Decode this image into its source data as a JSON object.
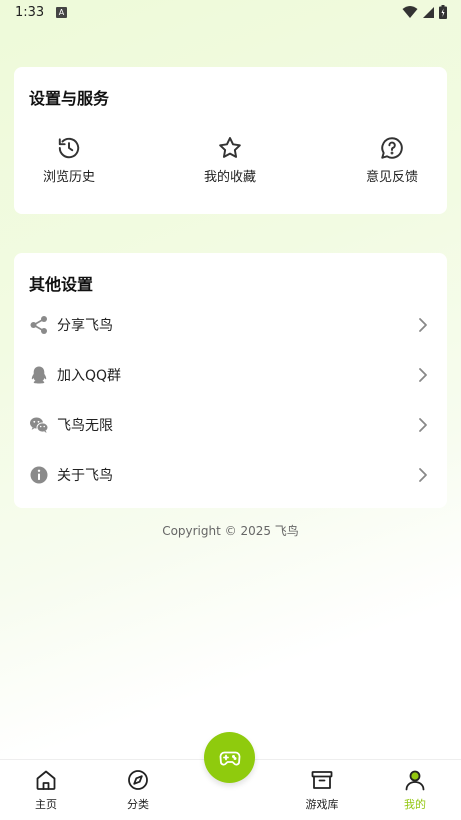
{
  "status_bar": {
    "time": "1:33",
    "badge": "A"
  },
  "services": {
    "title": "设置与服务",
    "items": [
      {
        "label": "浏览历史",
        "icon": "history-icon"
      },
      {
        "label": "我的收藏",
        "icon": "star-icon"
      },
      {
        "label": "意见反馈",
        "icon": "feedback-icon"
      }
    ]
  },
  "other": {
    "title": "其他设置",
    "items": [
      {
        "label": "分享飞鸟",
        "icon": "share-icon"
      },
      {
        "label": "加入QQ群",
        "icon": "qq-icon"
      },
      {
        "label": "飞鸟无限",
        "icon": "wechat-icon"
      },
      {
        "label": "关于飞鸟",
        "icon": "info-icon"
      }
    ]
  },
  "copyright": "Copyright © 2025 飞鸟",
  "tabs": [
    {
      "label": "主页",
      "icon": "home-icon"
    },
    {
      "label": "分类",
      "icon": "compass-icon"
    },
    {
      "label": "游戏库",
      "icon": "archive-icon"
    },
    {
      "label": "我的",
      "icon": "profile-icon",
      "active": true
    }
  ],
  "colors": {
    "accent": "#8fcb0d",
    "active_tab": "#93c711"
  }
}
